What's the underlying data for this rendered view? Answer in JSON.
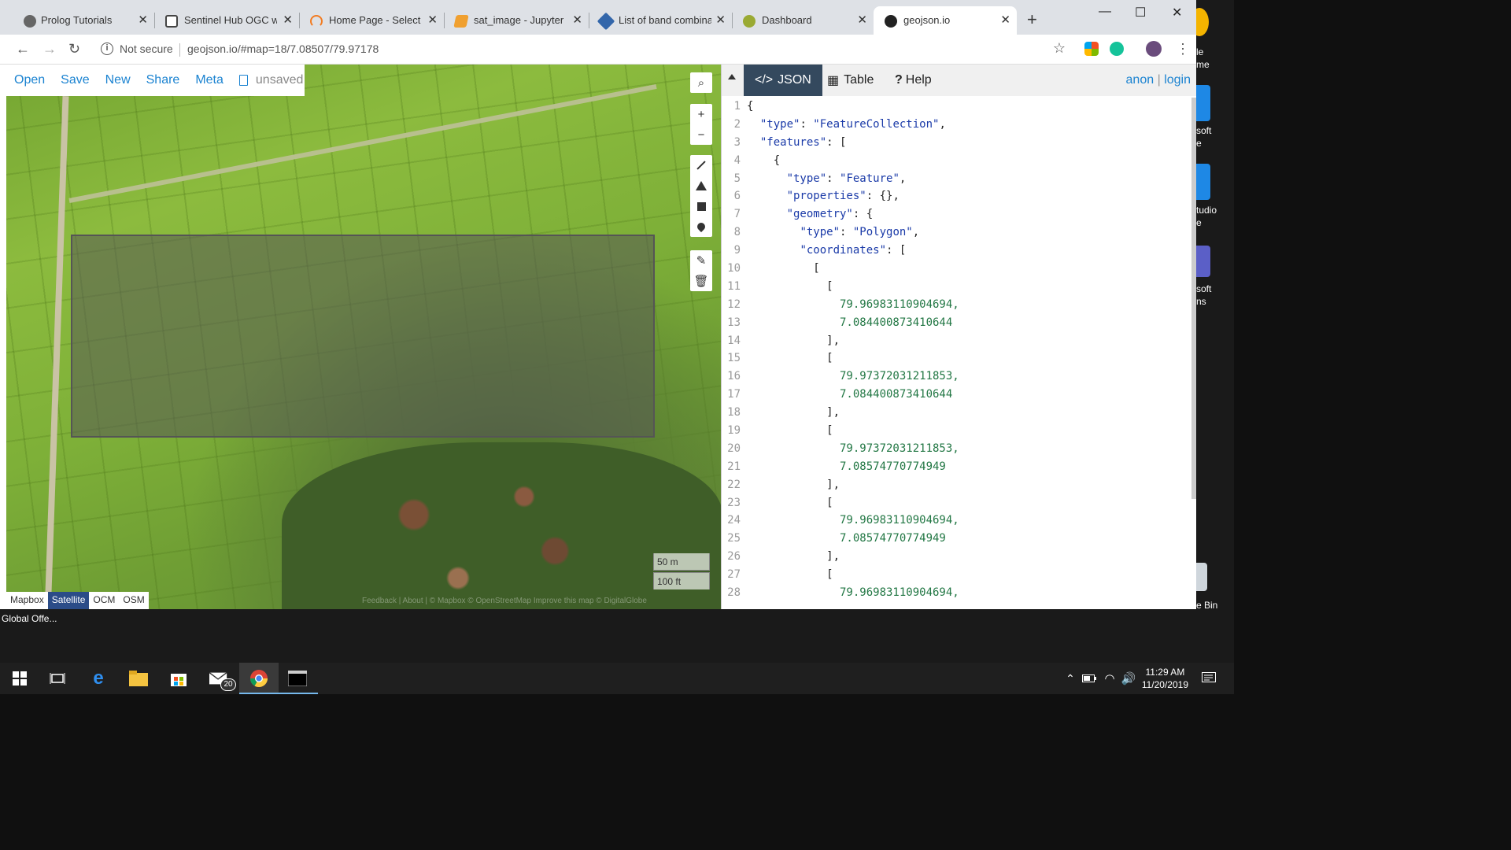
{
  "tabs": [
    {
      "label": "Prolog Tutorials",
      "icon": "globe-icon",
      "color": "#555555"
    },
    {
      "label": "Sentinel Hub OGC we",
      "icon": "doc-icon",
      "color": "#444444"
    },
    {
      "label": "Home Page - Select o",
      "icon": "loader-icon",
      "color": "#f27b21"
    },
    {
      "label": "sat_image - Jupyter N",
      "icon": "notebook-icon",
      "color": "#f0a030"
    },
    {
      "label": "List of band combinat",
      "icon": "satellite-icon",
      "color": "#3366aa"
    },
    {
      "label": "Dashboard",
      "icon": "leaf-icon",
      "color": "#9aaa33"
    },
    {
      "label": "geojson.io",
      "icon": "geojson-icon",
      "color": "#222222"
    }
  ],
  "window": {
    "minimize": "—",
    "maximize": "☐",
    "close": "✕",
    "new_tab": "+"
  },
  "address": {
    "security": "Not secure",
    "url": "geojson.io/#map=18/7.08507/79.97178"
  },
  "map_menu": {
    "open": "Open",
    "save": "Save",
    "new": "New",
    "share": "Share",
    "meta": "Meta",
    "unsaved": "unsaved"
  },
  "scale": {
    "metric": "50 m",
    "imperial": "100 ft"
  },
  "layers": [
    "Mapbox",
    "Satellite",
    "OCM",
    "OSM"
  ],
  "active_layer": "Satellite",
  "attribution": "Feedback | About | © Mapbox © OpenStreetMap Improve this map © DigitalGlobe",
  "panel": {
    "tabs": [
      {
        "label": "JSON",
        "icon": "code-icon",
        "glyph": "</>"
      },
      {
        "label": "Table",
        "icon": "table-icon",
        "glyph": "▦"
      },
      {
        "label": "Help",
        "icon": "help-icon",
        "glyph": "?"
      }
    ],
    "user": "anon",
    "separator": "|",
    "login": "login"
  },
  "code_lines": [
    {
      "n": "1",
      "t": "{"
    },
    {
      "n": "2",
      "t": "  \"type\": \"FeatureCollection\","
    },
    {
      "n": "3",
      "t": "  \"features\": ["
    },
    {
      "n": "4",
      "t": "    {"
    },
    {
      "n": "5",
      "t": "      \"type\": \"Feature\","
    },
    {
      "n": "6",
      "t": "      \"properties\": {},"
    },
    {
      "n": "7",
      "t": "      \"geometry\": {"
    },
    {
      "n": "8",
      "t": "        \"type\": \"Polygon\","
    },
    {
      "n": "9",
      "t": "        \"coordinates\": ["
    },
    {
      "n": "10",
      "t": "          ["
    },
    {
      "n": "11",
      "t": "            ["
    },
    {
      "n": "12",
      "t": "              79.96983110904694,"
    },
    {
      "n": "13",
      "t": "              7.084400873410644"
    },
    {
      "n": "14",
      "t": "            ],"
    },
    {
      "n": "15",
      "t": "            ["
    },
    {
      "n": "16",
      "t": "              79.97372031211853,"
    },
    {
      "n": "17",
      "t": "              7.084400873410644"
    },
    {
      "n": "18",
      "t": "            ],"
    },
    {
      "n": "19",
      "t": "            ["
    },
    {
      "n": "20",
      "t": "              79.97372031211853,"
    },
    {
      "n": "21",
      "t": "              7.08574770774949"
    },
    {
      "n": "22",
      "t": "            ],"
    },
    {
      "n": "23",
      "t": "            ["
    },
    {
      "n": "24",
      "t": "              79.96983110904694,"
    },
    {
      "n": "25",
      "t": "              7.08574770774949"
    },
    {
      "n": "26",
      "t": "            ],"
    },
    {
      "n": "27",
      "t": "            ["
    },
    {
      "n": "28",
      "t": "              79.96983110904694,"
    }
  ],
  "desktop": {
    "labels": [
      "le",
      "me",
      "soft",
      "e",
      "tudio",
      "e",
      "soft",
      "ns",
      "e Bin"
    ],
    "footer": "Global Offe..."
  },
  "taskbar": {
    "mail_badge": "20",
    "time": "11:29 AM",
    "date": "11/20/2019"
  }
}
